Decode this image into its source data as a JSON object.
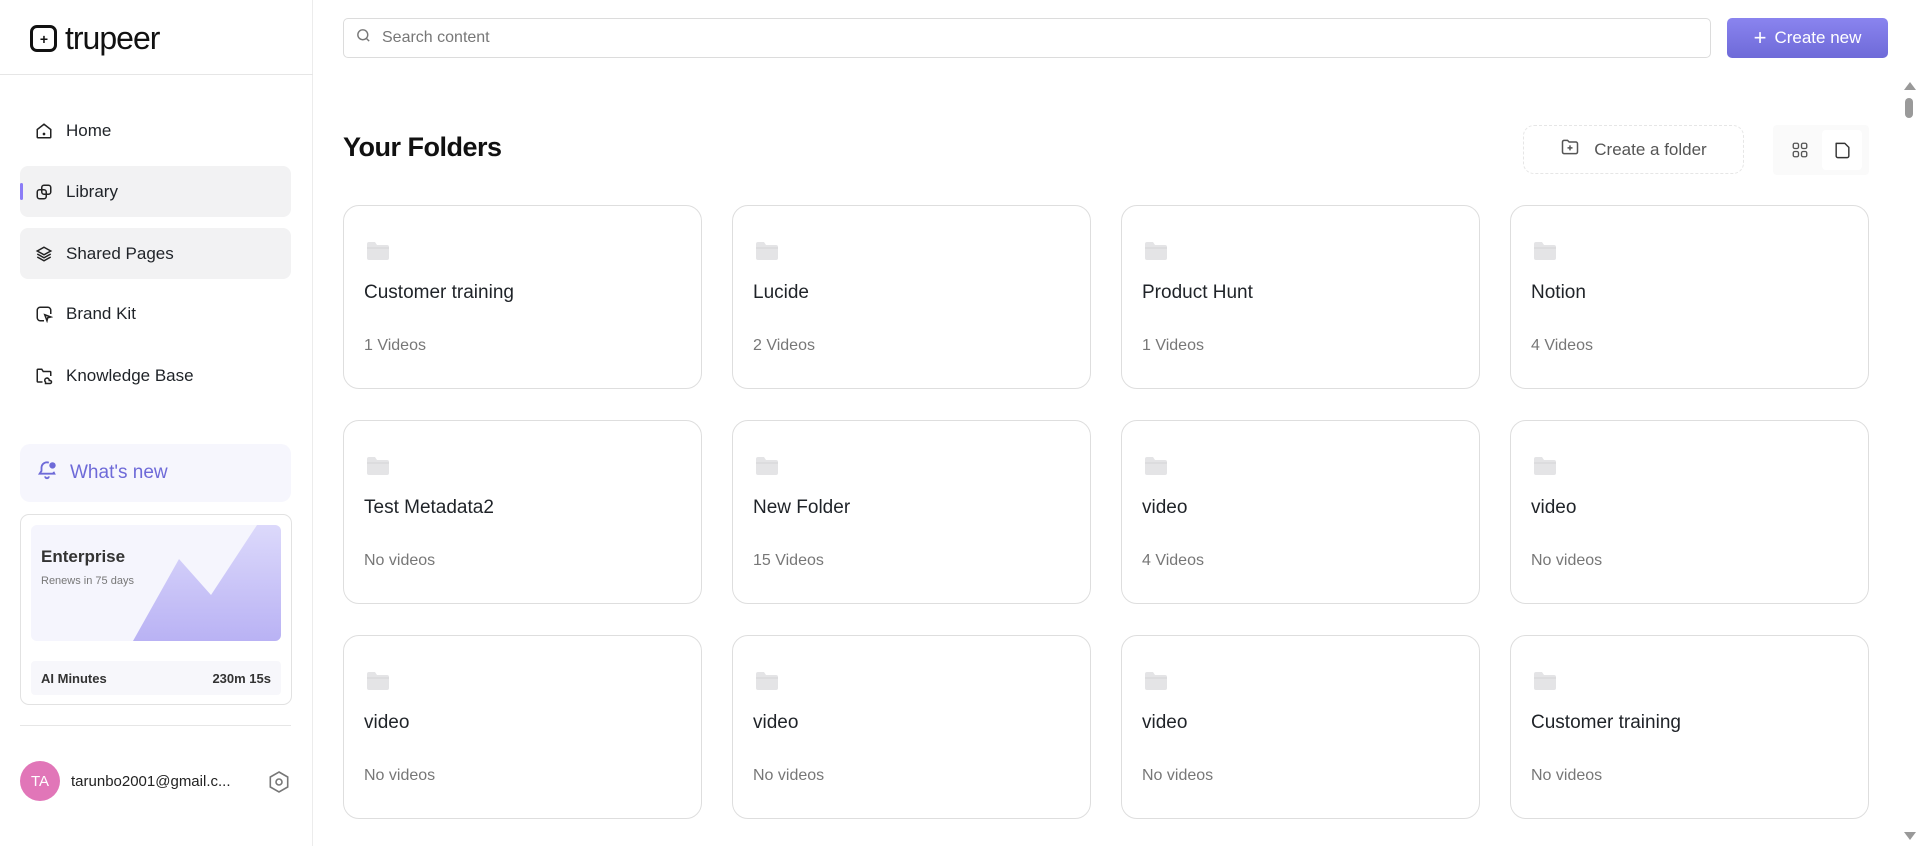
{
  "brand": {
    "name": "trupeer"
  },
  "sidebar": {
    "items": [
      {
        "label": "Home",
        "icon": "home-icon"
      },
      {
        "label": "Library",
        "icon": "library-icon"
      },
      {
        "label": "Shared Pages",
        "icon": "layers-icon"
      },
      {
        "label": "Brand Kit",
        "icon": "brand-kit-icon"
      },
      {
        "label": "Knowledge Base",
        "icon": "folder-cloud-icon"
      }
    ],
    "whats_new": "What's new",
    "plan": {
      "name": "Enterprise",
      "renews": "Renews in 75 days",
      "minutes_label": "AI Minutes",
      "minutes_value": "230m 15s"
    },
    "user": {
      "initials": "TA",
      "email": "tarunbo2001@gmail.c..."
    }
  },
  "header": {
    "search_placeholder": "Search content",
    "create_new": "Create new"
  },
  "main": {
    "title": "Your Folders",
    "create_folder": "Create a folder",
    "folders": [
      {
        "name": "Customer training",
        "count": "1 Videos"
      },
      {
        "name": "Lucide",
        "count": "2 Videos"
      },
      {
        "name": "Product Hunt",
        "count": "1 Videos"
      },
      {
        "name": "Notion",
        "count": "4 Videos"
      },
      {
        "name": "Test Metadata2",
        "count": "No videos"
      },
      {
        "name": "New Folder",
        "count": "15 Videos"
      },
      {
        "name": "video",
        "count": "4 Videos"
      },
      {
        "name": "video",
        "count": "No videos"
      },
      {
        "name": "video",
        "count": "No videos"
      },
      {
        "name": "video",
        "count": "No videos"
      },
      {
        "name": "video",
        "count": "No videos"
      },
      {
        "name": "Customer training",
        "count": "No videos"
      }
    ]
  },
  "colors": {
    "accent": "#6e6ad8",
    "avatar": "#e176b8"
  }
}
